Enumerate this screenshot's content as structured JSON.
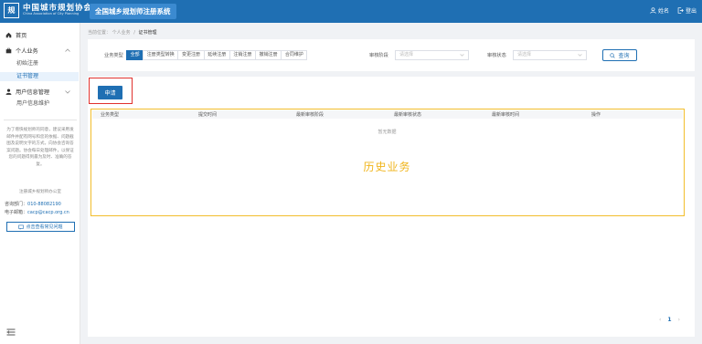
{
  "header": {
    "logo_mark": "规",
    "logo_cn": "中国城市规划协会",
    "logo_en": "China Association of City Planning",
    "system_title": "全国城乡规划师注册系统",
    "user_label": "姓名",
    "logout_label": "登出"
  },
  "sidebar": {
    "home": "首页",
    "personal_business": "个人业务",
    "initial_registration": "初始注册",
    "certificate_management": "证书管理",
    "user_info_management": "用户信息管理",
    "user_info_maintenance": "用户信息维护",
    "notice": "为了增快规划师的同意，建议采用发邮件并配有网号和您的依据、问题截图及说明文字的方式，向协会咨询答案问题。协会每日处理邮件，以保证您的问题得到最为及时、准确的答复。",
    "notice_sign": "注册城乡规划师办公室",
    "phone_label": "咨询部门：",
    "phone": "010-88082190",
    "email_label": "电子邮箱：",
    "email": "cacp@cacp.org.cn",
    "faq_button": "点击查看常见问题"
  },
  "breadcrumb": {
    "location_label": "当前位置：",
    "parent": "个人业务",
    "separator": "/",
    "current": "证书管理"
  },
  "filter": {
    "business_type_label": "业务类型",
    "tabs": [
      "全部",
      "注册类型转换",
      "变更注册",
      "延续注册",
      "注销注册",
      "撤销注册",
      "合同维护"
    ],
    "audit_stage_label": "审核阶段",
    "audit_stage_placeholder": "请选择",
    "audit_status_label": "审核状态",
    "audit_status_placeholder": "请选择",
    "query_button": "查询"
  },
  "list": {
    "apply_button": "申请",
    "columns": [
      "业务类型",
      "提交时间",
      "最新审核阶段",
      "最新审核状态",
      "最新审核时间",
      "操作"
    ],
    "empty_text": "暂无数据",
    "history_label": "历史业务",
    "current_page": "1"
  },
  "colors": {
    "primary": "#1f6fb3",
    "highlight_red": "#e0312d",
    "highlight_yellow": "#f2bd2c"
  }
}
